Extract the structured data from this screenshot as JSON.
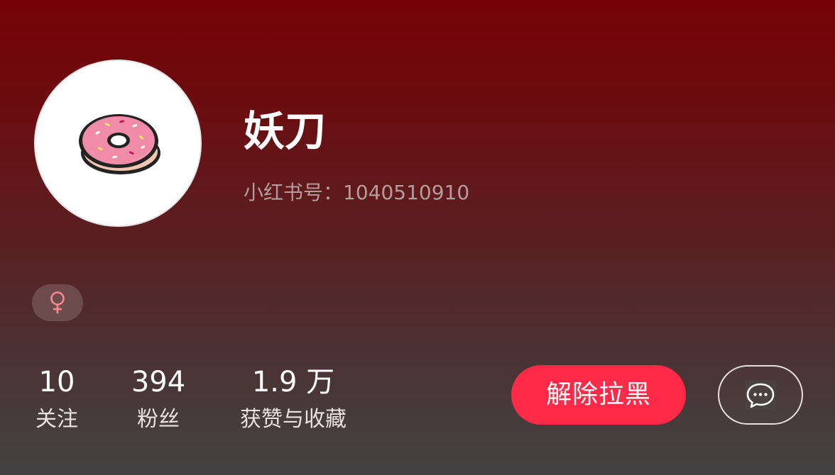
{
  "profile": {
    "username": "妖刀",
    "id_label": "小红书号：",
    "id_value": "1040510910",
    "gender_icon": "female-icon",
    "avatar_icon": "donut-icon"
  },
  "stats": [
    {
      "value": "10",
      "label": "关注"
    },
    {
      "value": "394",
      "label": "粉丝"
    },
    {
      "value": "1.9 万",
      "label": "获赞与收藏"
    }
  ],
  "actions": {
    "unblock_label": "解除拉黑",
    "message_icon": "chat-bubble-icon"
  },
  "colors": {
    "accent": "#fe2a47",
    "gender": "#f38a92",
    "background_top": "#750205",
    "background_bottom": "#434343"
  }
}
